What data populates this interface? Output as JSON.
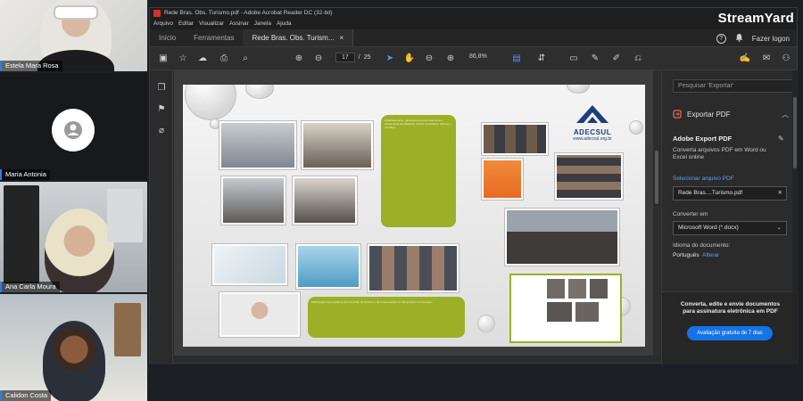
{
  "brand": {
    "streamyard": "StreamYard"
  },
  "participants": [
    {
      "name": "Estela Mara Rosa"
    },
    {
      "name": "Maria Antonia"
    },
    {
      "name": "Ana Carla Moura"
    },
    {
      "name": "Calidon Costa"
    }
  ],
  "acrobat": {
    "window_title": "Rede Bras. Obs. Turismo.pdf - Adobe Acrobat Reader DC (32-bit)",
    "menu": [
      "Arquivo",
      "Editar",
      "Visualizar",
      "Assinar",
      "Janela",
      "Ajuda"
    ],
    "tabs": {
      "home": "Início",
      "tools": "Ferramentas",
      "doc": "Rede Bras. Obs. Turism...",
      "doc_close": "×"
    },
    "header_right": {
      "help": "?",
      "login": "Fazer logon"
    },
    "page": {
      "current": "17",
      "separator": "/",
      "total": "25"
    },
    "zoom": "86,8%",
    "document": {
      "logo_word": "ADECSUL",
      "logo_url": "www.adecsul.org.br",
      "green_box_1": "Atividades Afins: participamos presencialmente e virtualmente de palestras, cursos, seminários, oficinas e reuniões...",
      "green_box_2": "Participação da presidente da Comissão de Turismo e da Coordenadora do Observatório na Jornada..."
    },
    "right_panel": {
      "search_placeholder": "Pesquisar 'Exportar'",
      "export_title": "Exportar PDF",
      "export_section_title": "Adobe Export PDF",
      "export_section_text": "Converta arquivos PDF em Word ou Excel online",
      "select_file_link": "Selecionar arquivo PDF",
      "file_value": "Rede Bras....Turismo.pdf",
      "convert_label": "Converter em",
      "convert_value": "Microsoft Word (*.docx)",
      "language_label": "Idioma do documento:",
      "language_value": "Português",
      "language_change": "Alterar",
      "promo_text": "Converta, edite e envie documentos para assinatura eletrônica em PDF",
      "promo_button": "Avaliação gratuita de 7 dias"
    }
  },
  "colors": {
    "adobe_blue": "#1473e6",
    "pdf_red": "#d4302b",
    "green_box": "#9bb027",
    "adecsul_navy": "#1c3f7a"
  }
}
